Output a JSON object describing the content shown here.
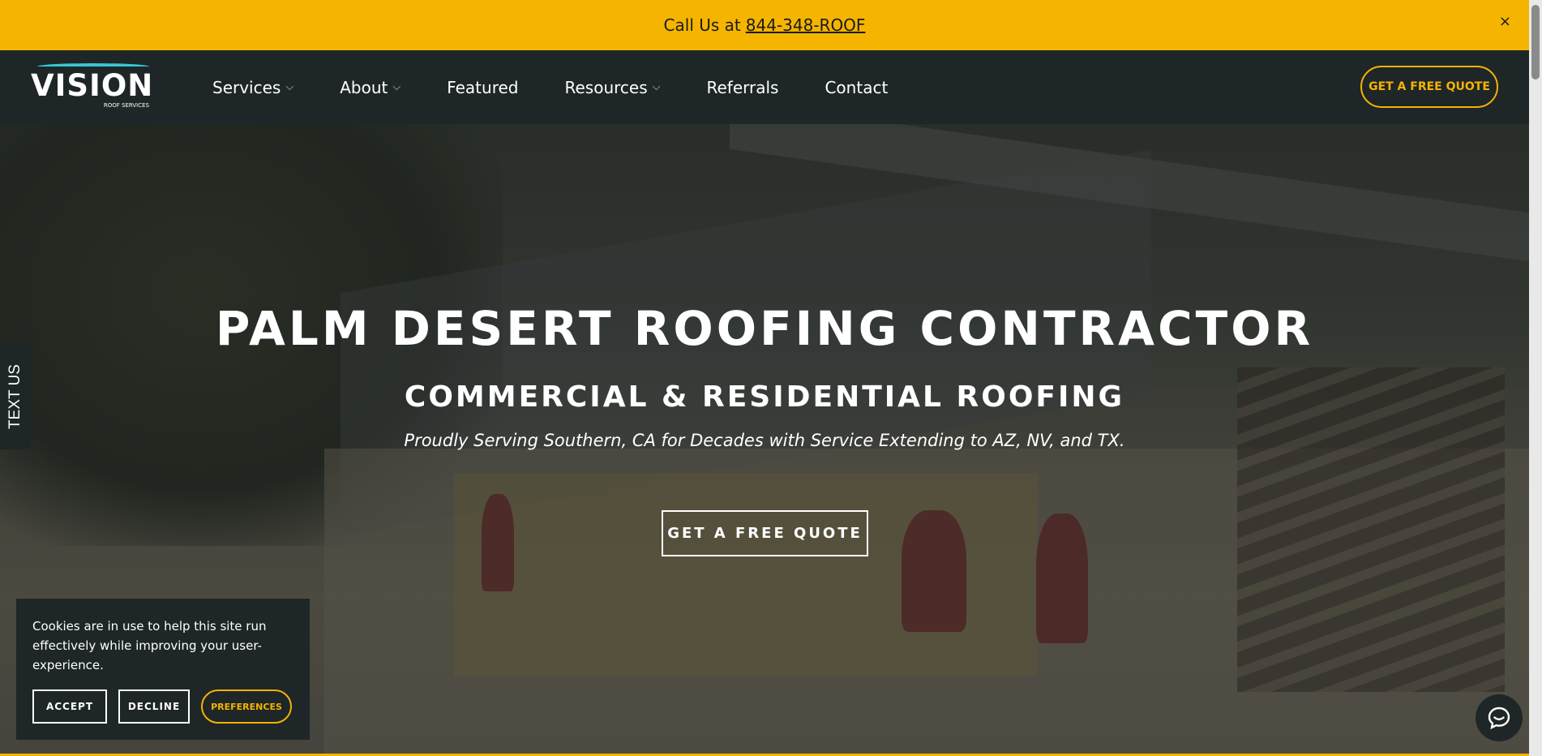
{
  "topbar": {
    "prefix": "Call Us at",
    "phone": "844-348-ROOF",
    "close": "×",
    "color": "#f4b400"
  },
  "brand": {
    "logo_text": "VISION",
    "logo_sub": "ROOF SERVICES",
    "accent": "#38c6d3"
  },
  "nav": {
    "items": [
      {
        "label": "Services",
        "has_dropdown": true
      },
      {
        "label": "About",
        "has_dropdown": true
      },
      {
        "label": "Featured",
        "has_dropdown": false
      },
      {
        "label": "Resources",
        "has_dropdown": true
      },
      {
        "label": "Referrals",
        "has_dropdown": false
      },
      {
        "label": "Contact",
        "has_dropdown": false
      }
    ],
    "chevron": "⌵",
    "cta": "GET A FREE QUOTE"
  },
  "hero": {
    "title": "PALM DESERT ROOFING CONTRACTOR",
    "subtitle": "COMMERCIAL & RESIDENTIAL ROOFING",
    "tagline": "Proudly Serving Southern, CA for Decades with Service Extending to AZ, NV, and TX.",
    "cta": "GET A FREE QUOTE"
  },
  "side_tab": {
    "label": "TEXT US"
  },
  "cookie": {
    "message": "Cookies are in use to help this site run effectively while improving your user-experience.",
    "accept": "ACCEPT",
    "decline": "DECLINE",
    "preferences": "PREFERENCES"
  },
  "chat": {
    "icon": "chat-icon"
  }
}
